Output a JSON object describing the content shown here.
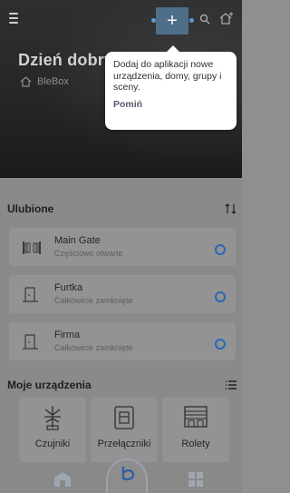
{
  "topbar": {
    "menu_icon": "hamburger-icon",
    "add_button_label": "+",
    "search_icon": "search-icon",
    "add_home_icon": "home-plus-icon"
  },
  "hero": {
    "greeting": "Dzień dobry",
    "home_icon": "house-icon",
    "home_name": "BleBox"
  },
  "tooltip": {
    "message": "Dodaj do aplikacji nowe urządzenia, domy, grupy i sceny.",
    "skip_label": "Pomiń"
  },
  "favorites": {
    "title": "Ulubione",
    "sort_icon": "sort-icon",
    "items": [
      {
        "name": "Main Gate",
        "state": "Częściowo otwarte",
        "icon": "gate-icon"
      },
      {
        "name": "Furtka",
        "state": "Całkowicie zamknięte",
        "icon": "wicket-icon"
      },
      {
        "name": "Firma",
        "state": "Całkowicie zamknięte",
        "icon": "wicket-icon"
      }
    ]
  },
  "devices": {
    "title": "Moje urządzenia",
    "list_icon": "list-icon",
    "categories": [
      {
        "label": "Czujniki",
        "icon": "sensor-icon"
      },
      {
        "label": "Przełączniki",
        "icon": "switch-icon"
      },
      {
        "label": "Rolety",
        "icon": "shutter-icon"
      }
    ]
  },
  "bottom_nav": {
    "items": [
      "home-icon",
      "blebox-logo-icon",
      "grid-icon"
    ]
  },
  "colors": {
    "accent": "#2a66b8",
    "tooltip_bg": "#ffffff",
    "overlay": "#8a8a8a"
  }
}
